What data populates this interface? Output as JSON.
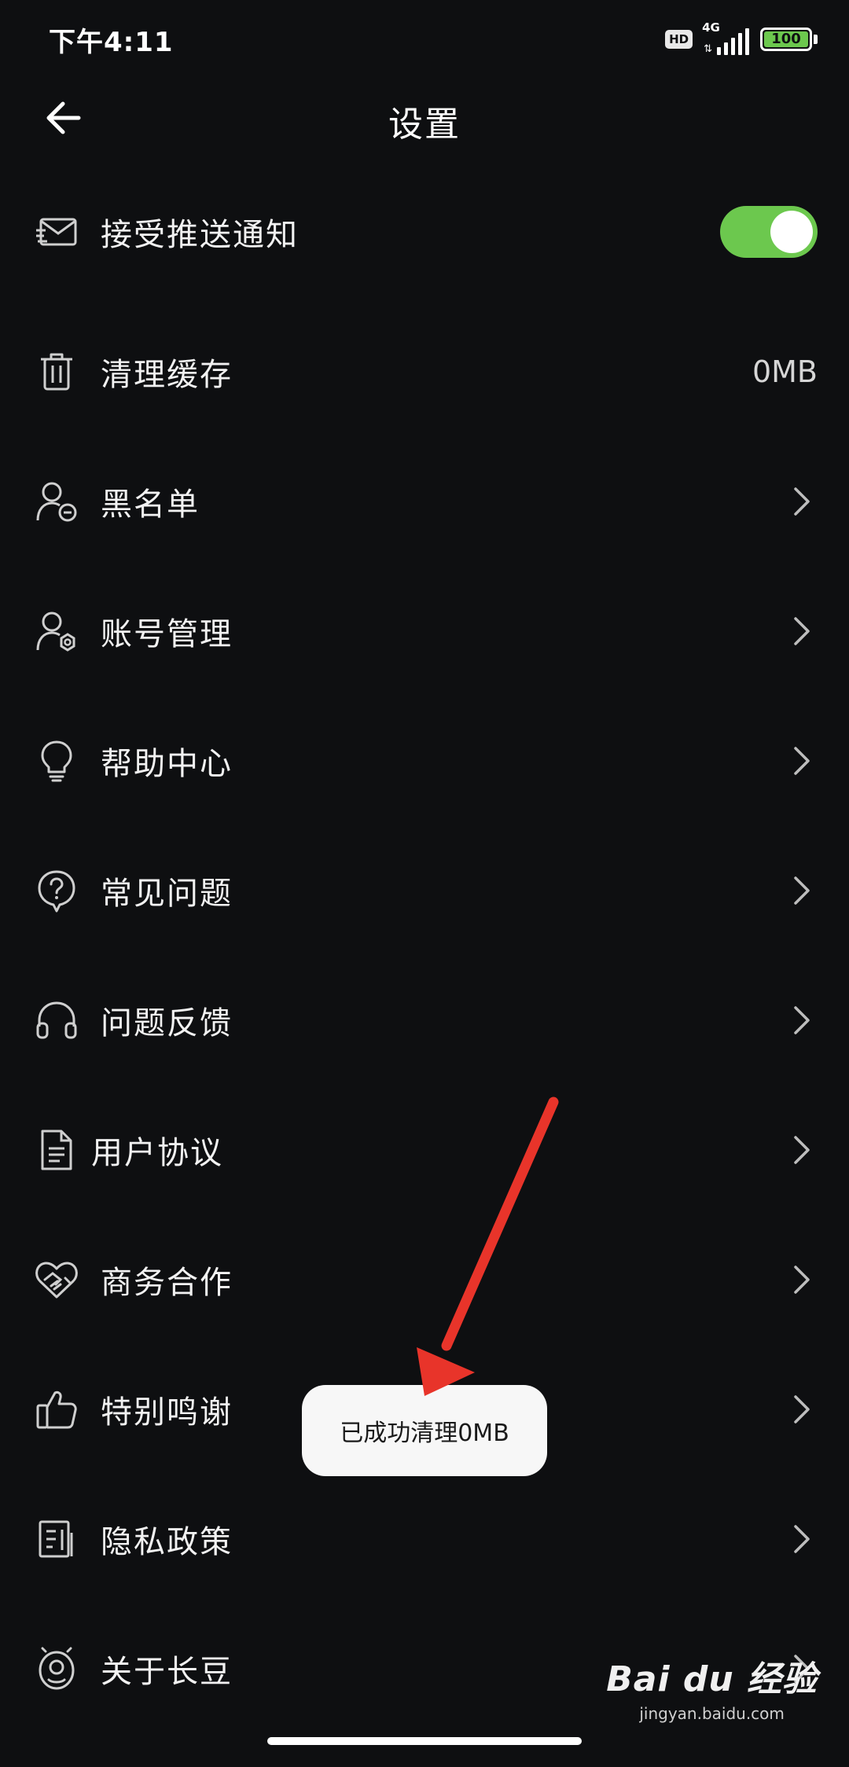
{
  "status_bar": {
    "time": "下午4:11",
    "hd_label": "HD",
    "network_label": "4G",
    "battery_level": "100"
  },
  "header": {
    "title": "设置"
  },
  "settings": {
    "push": {
      "label": "接受推送通知",
      "enabled": true
    },
    "cache": {
      "label": "清理缓存",
      "value": "0MB"
    },
    "blacklist": {
      "label": "黑名单"
    },
    "account": {
      "label": "账号管理"
    },
    "help": {
      "label": "帮助中心"
    },
    "faq": {
      "label": "常见问题"
    },
    "feedback": {
      "label": "问题反馈"
    },
    "agreement": {
      "label": "用户协议"
    },
    "business": {
      "label": "商务合作"
    },
    "thanks": {
      "label": "特别鸣谢"
    },
    "privacy": {
      "label": "隐私政策"
    },
    "about": {
      "label": "关于长豆"
    }
  },
  "toast": {
    "message": "已成功清理0MB"
  },
  "watermark": {
    "logo": "Bai du 经验",
    "site": "jingyan.baidu.com"
  },
  "colors": {
    "background": "#0e0f11",
    "toggle_on": "#6cc84e",
    "annotation": "#e8342a"
  }
}
